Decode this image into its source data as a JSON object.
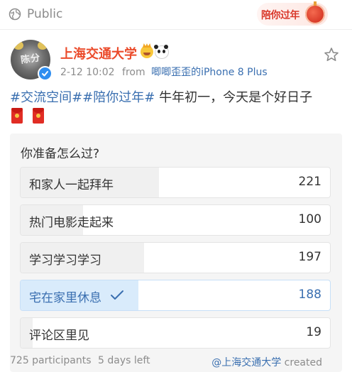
{
  "header": {
    "visibility_label": "Public",
    "festival_badge_text": "陪你过年"
  },
  "post": {
    "author": {
      "name": "上海交通大学",
      "avatar_text": "陈分"
    },
    "meta": {
      "time": "2-12 10:02",
      "from_label": "from",
      "source": "唧唧歪歪的iPhone 8 Plus"
    },
    "content": {
      "tag1": "#交流空间#",
      "tag2": "#陪你过年#",
      "text": " 牛年初一，今天是个好日子"
    }
  },
  "vote": {
    "question": "你准备怎么过?",
    "options": [
      {
        "label": "和家人一起拜年",
        "count": "221",
        "share": 0.447,
        "selected": false
      },
      {
        "label": "热门电影走起来",
        "count": "100",
        "share": 0.202,
        "selected": false
      },
      {
        "label": "学习学习学习",
        "count": "197",
        "share": 0.398,
        "selected": false
      },
      {
        "label": "宅在家里休息",
        "count": "188",
        "share": 0.38,
        "selected": true
      },
      {
        "label": "评论区里见",
        "count": "19",
        "share": 0.038,
        "selected": false
      }
    ],
    "footer": {
      "participants": "725 participants",
      "deadline": "5 days left",
      "creator": "@上海交通大学",
      "created_label": "created"
    }
  },
  "colors": {
    "accent": "#3a6fb0",
    "username": "#eb4b2b",
    "selected_fill": "#d9ebfb"
  }
}
